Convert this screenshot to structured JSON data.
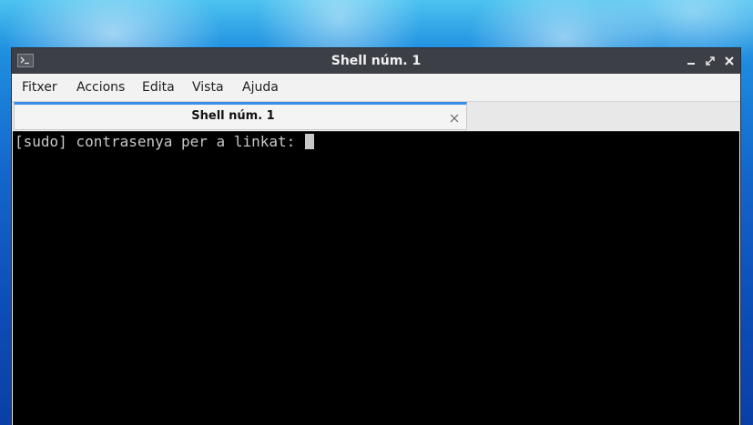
{
  "window": {
    "title": "Shell núm. 1",
    "controls": [
      "minimize-icon",
      "maximize-icon",
      "close-icon"
    ]
  },
  "menubar": {
    "items": [
      "Fitxer",
      "Accions",
      "Edita",
      "Vista",
      "Ajuda"
    ]
  },
  "tabs": [
    {
      "label": "Shell núm. 1",
      "active": true
    }
  ],
  "terminal": {
    "prompt": "[sudo] contrasenya per a linkat: "
  },
  "colors": {
    "titlebar": "#3c3f46",
    "tab_accent": "#3a8ee6",
    "terminal_bg": "#000000",
    "terminal_fg": "#c8c8c8"
  }
}
